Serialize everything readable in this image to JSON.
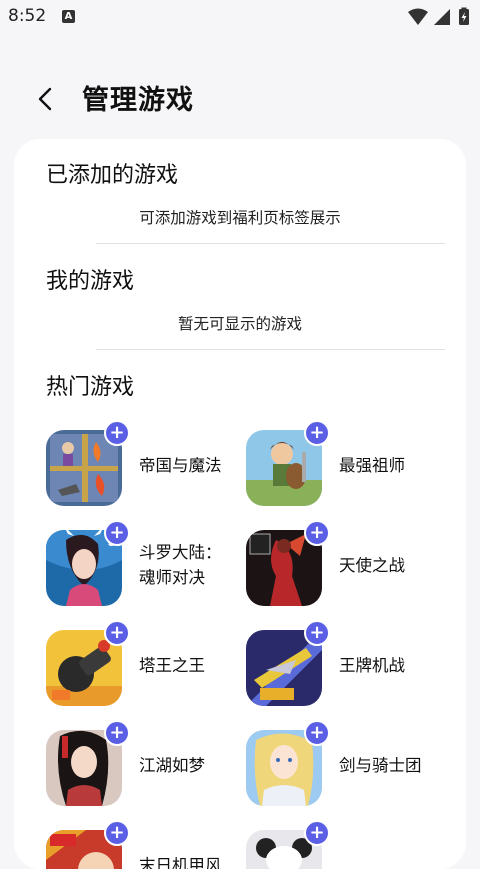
{
  "status_bar": {
    "time": "8:52",
    "notification_icon": "A"
  },
  "header": {
    "title": "管理游戏"
  },
  "added_section": {
    "title": "已添加的游戏",
    "subtitle": "可添加游戏到福利页标签展示"
  },
  "my_section": {
    "title": "我的游戏",
    "subtitle": "暂无可显示的游戏"
  },
  "hot_section": {
    "title": "热门游戏",
    "games": [
      {
        "name": "帝国与魔法",
        "add": "+"
      },
      {
        "name": "最强祖师",
        "add": "+"
      },
      {
        "name": "斗罗大陆：魂师对决",
        "line1": "斗罗大陆：",
        "line2": "魂师对决",
        "add": "+"
      },
      {
        "name": "天使之战",
        "add": "+"
      },
      {
        "name": "塔王之王",
        "add": "+"
      },
      {
        "name": "王牌机战",
        "add": "+"
      },
      {
        "name": "江湖如梦",
        "add": "+"
      },
      {
        "name": "剑与骑士团",
        "add": "+"
      },
      {
        "name": "末日机甲风",
        "add": "+"
      },
      {
        "name": "",
        "add": "+"
      }
    ]
  },
  "colors": {
    "accent": "#5b5fe6",
    "card_bg": "#ffffff",
    "page_bg": "#f6f6f8"
  }
}
